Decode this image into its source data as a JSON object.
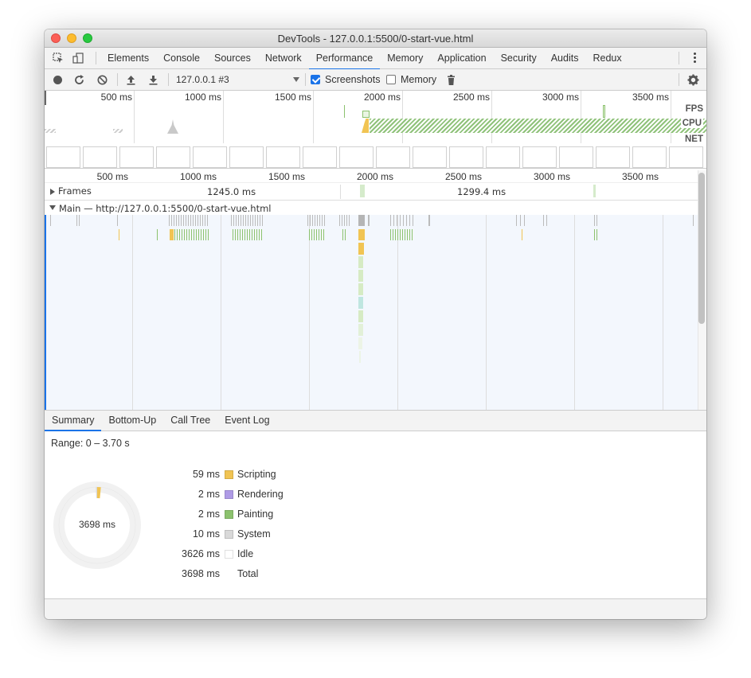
{
  "window": {
    "title": "DevTools - 127.0.0.1:5500/0-start-vue.html"
  },
  "tabs": [
    {
      "label": "Elements"
    },
    {
      "label": "Console"
    },
    {
      "label": "Sources"
    },
    {
      "label": "Network"
    },
    {
      "label": "Performance",
      "active": true
    },
    {
      "label": "Memory"
    },
    {
      "label": "Application"
    },
    {
      "label": "Security"
    },
    {
      "label": "Audits"
    },
    {
      "label": "Redux"
    }
  ],
  "toolbar": {
    "target": "127.0.0.1 #3",
    "screenshots_label": "Screenshots",
    "screenshots_checked": true,
    "memory_label": "Memory",
    "memory_checked": false
  },
  "overview": {
    "ruler": [
      "500 ms",
      "1000 ms",
      "1500 ms",
      "2000 ms",
      "2500 ms",
      "3000 ms",
      "3500 ms"
    ],
    "tracks": {
      "fps": "FPS",
      "cpu": "CPU",
      "net": "NET"
    }
  },
  "flamechart": {
    "ruler": [
      "500 ms",
      "1000 ms",
      "1500 ms",
      "2000 ms",
      "2500 ms",
      "3000 ms",
      "3500 ms"
    ],
    "frames_label": "Frames",
    "frame_durations": [
      "1245.0 ms",
      "1299.4 ms"
    ],
    "main_label": "Main — http://127.0.0.1:5500/0-start-vue.html"
  },
  "bottom_tabs": [
    {
      "label": "Summary",
      "active": true
    },
    {
      "label": "Bottom-Up"
    },
    {
      "label": "Call Tree"
    },
    {
      "label": "Event Log"
    }
  ],
  "summary": {
    "range": "Range: 0 – 3.70 s",
    "total_center": "3698 ms",
    "items": [
      {
        "value": "59 ms",
        "label": "Scripting",
        "color": "#f1c453"
      },
      {
        "value": "2 ms",
        "label": "Rendering",
        "color": "#af9be6"
      },
      {
        "value": "2 ms",
        "label": "Painting",
        "color": "#8cc26e"
      },
      {
        "value": "10 ms",
        "label": "System",
        "color": "#d9d9d9"
      },
      {
        "value": "3626 ms",
        "label": "Idle",
        "color": "#ffffff"
      },
      {
        "value": "3698 ms",
        "label": "Total",
        "color": ""
      }
    ]
  },
  "colors": {
    "accent": "#1a73e8",
    "scripting": "#f1c453",
    "painting": "#8cc26e",
    "system": "#d9d9d9"
  }
}
